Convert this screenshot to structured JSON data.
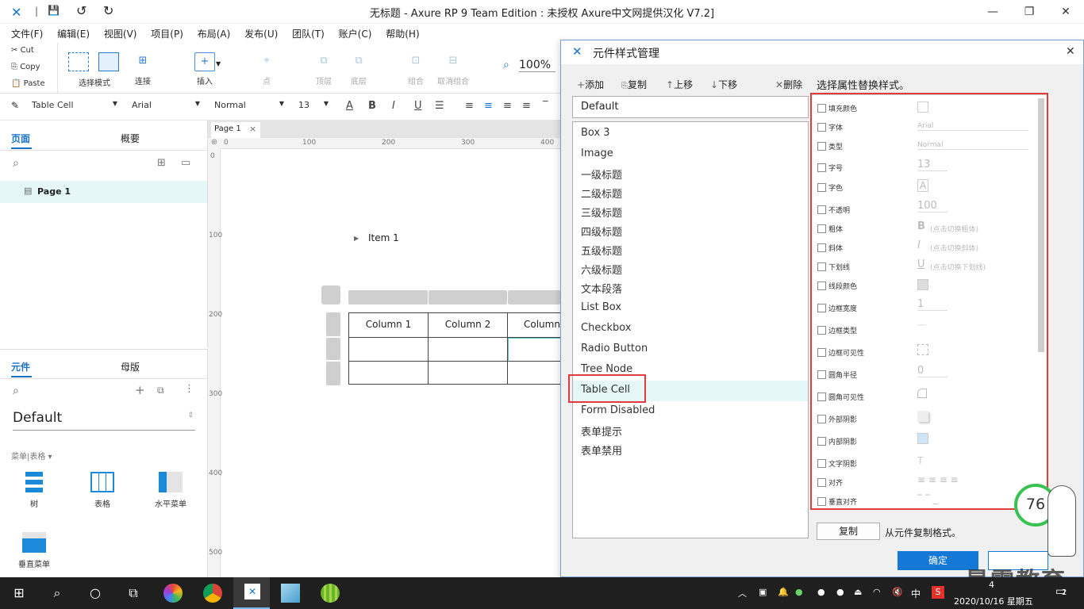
{
  "window": {
    "title": "无标题 - Axure RP 9 Team Edition : 未授权      Axure中文网提供汉化 V7.2]",
    "minimize": "—",
    "maximize": "❐",
    "close": "✕"
  },
  "quick": {
    "save": "💾",
    "undo": "↺",
    "redo": "↻"
  },
  "menu": [
    "文件(F)",
    "编辑(E)",
    "视图(V)",
    "项目(P)",
    "布局(A)",
    "发布(U)",
    "团队(T)",
    "账户(C)",
    "帮助(H)"
  ],
  "clipboard": {
    "cut": "Cut",
    "copy": "Copy",
    "paste": "Paste"
  },
  "toolbar": {
    "select_mode": "选择模式",
    "connect": "连接",
    "insert": "插入",
    "point": "点",
    "top": "顶层",
    "bottom": "底层",
    "group": "组合",
    "ungroup": "取消组合",
    "zoom": "100%"
  },
  "format": {
    "style": "Table Cell",
    "font": "Arial",
    "weight": "Normal",
    "size": "13",
    "bold": "B",
    "italic": "I",
    "underline": "U"
  },
  "pages_panel": {
    "tab_pages": "页面",
    "tab_outline": "概要",
    "page_item": "Page 1"
  },
  "components_panel": {
    "tab_components": "元件",
    "tab_masters": "母版",
    "library": "Default",
    "category": "菜单|表格 ▾",
    "items": [
      "树",
      "表格",
      "水平菜单",
      "垂直菜单"
    ]
  },
  "canvas": {
    "tab_label": "Page 1",
    "tab_close": "×",
    "ruler_h": [
      "0",
      "100",
      "200",
      "300",
      "400"
    ],
    "ruler_v": [
      "0",
      "100",
      "200",
      "300",
      "400",
      "500"
    ],
    "tree_item": "Item 1",
    "table_headers": [
      "Column 1",
      "Column 2",
      "Column"
    ]
  },
  "dialog": {
    "title": "元件样式管理",
    "close": "✕",
    "add": "添加",
    "copy": "复制",
    "move_up": "上移",
    "move_down": "下移",
    "delete": "删除",
    "default_field": "Default",
    "prop_header": "选择属性替换样式。",
    "styles": [
      "Box 3",
      "Image",
      "一级标题",
      "二级标题",
      "三级标题",
      "四级标题",
      "五级标题",
      "六级标题",
      "文本段落",
      "List Box",
      "Checkbox",
      "Radio Button",
      "Tree Node",
      "Table Cell",
      "Form Disabled",
      "表单提示",
      "表单禁用"
    ],
    "selected_style": "Table Cell",
    "properties": [
      {
        "label": "填充颜色",
        "value": ""
      },
      {
        "label": "字体",
        "value": "Arial"
      },
      {
        "label": "类型",
        "value": "Normal"
      },
      {
        "label": "字号",
        "value": "13"
      },
      {
        "label": "字色",
        "value": ""
      },
      {
        "label": "不透明",
        "value": "100"
      },
      {
        "label": "粗体",
        "value": "(点击切换粗体)"
      },
      {
        "label": "斜体",
        "value": "(点击切换斜体)"
      },
      {
        "label": "下划线",
        "value": "(点击切换下划线)"
      },
      {
        "label": "线段颜色",
        "value": ""
      },
      {
        "label": "边框宽度",
        "value": "1"
      },
      {
        "label": "边框类型",
        "value": ""
      },
      {
        "label": "边框可见性",
        "value": ""
      },
      {
        "label": "圆角半径",
        "value": "0"
      },
      {
        "label": "圆角可见性",
        "value": ""
      },
      {
        "label": "外部阴影",
        "value": ""
      },
      {
        "label": "内部阴影",
        "value": ""
      },
      {
        "label": "文字阴影",
        "value": ""
      },
      {
        "label": "对齐",
        "value": ""
      },
      {
        "label": "垂直对齐",
        "value": ""
      }
    ],
    "copy_btn": "复制",
    "copy_from": "从元件复制格式。",
    "ok": "确定"
  },
  "overlay": {
    "gauge": "76",
    "watermark": "最需教育"
  },
  "taskbar": {
    "ime": "中",
    "time_partial": "4",
    "date": "2020/10/16 星期五",
    "notif": "2"
  },
  "colors": {
    "accent": "#1479d6",
    "highlight": "#e6f7f7",
    "annotation": "#e23b3b"
  }
}
